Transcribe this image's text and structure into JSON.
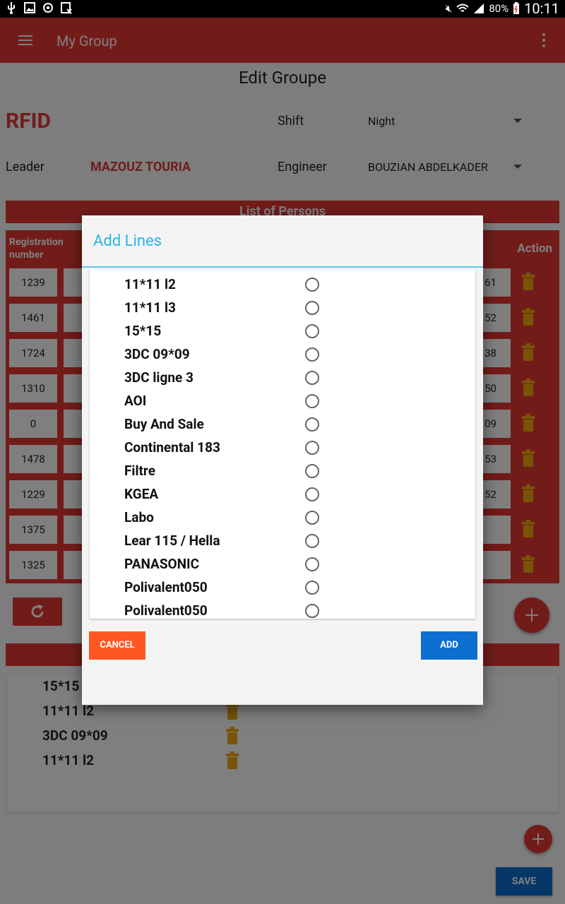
{
  "status_bar": {
    "battery": "80%",
    "time": "10:11"
  },
  "app_bar": {
    "title": "My Group"
  },
  "page": {
    "title": "Edit Groupe",
    "group_name": "RFID",
    "shift_label": "Shift",
    "shift_value": "Night",
    "leader_label": "Leader",
    "leader_value": "MAZOUZ TOURIA",
    "engineer_label": "Engineer",
    "engineer_value": "BOUZIAN ABDELKADER"
  },
  "persons": {
    "section_title": "List of Persons",
    "col_registration": "Registration number",
    "col_action": "Action",
    "rows": [
      {
        "registration": "1239",
        "right": "61"
      },
      {
        "registration": "1461",
        "right": "52"
      },
      {
        "registration": "1724",
        "right": "38"
      },
      {
        "registration": "1310",
        "right": "50"
      },
      {
        "registration": "0",
        "right": "09"
      },
      {
        "registration": "1478",
        "right": "53"
      },
      {
        "registration": "1229",
        "right": "52"
      },
      {
        "registration": "1375",
        "right": ""
      },
      {
        "registration": "1325",
        "right": ""
      }
    ]
  },
  "lines": {
    "items": [
      "15*15",
      "11*11 l2",
      "3DC 09*09",
      "11*11 l2"
    ]
  },
  "save_label": "SAVE",
  "dialog": {
    "title": "Add Lines",
    "options": [
      "11*11 l2",
      "11*11 l3",
      "15*15",
      "3DC 09*09",
      "3DC ligne 3",
      "AOI",
      "Buy And Sale",
      "Continental 183",
      "Filtre",
      "KGEA",
      "Labo",
      "Lear 115 / Hella",
      "PANASONIC",
      "Polivalent050",
      "Polivalent050"
    ],
    "cancel_label": "CANCEL",
    "add_label": "ADD"
  },
  "colors": {
    "primary": "#e53935",
    "accent_blue": "#0d6fd1",
    "cancel_orange": "#ff5722",
    "dialog_title": "#29b6e8",
    "trash": "#f2a90c"
  }
}
